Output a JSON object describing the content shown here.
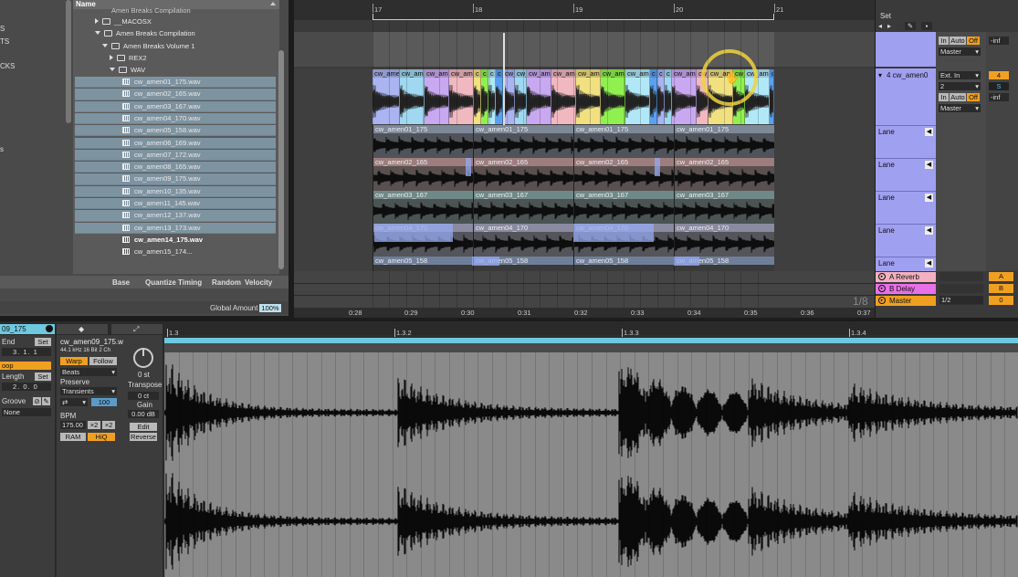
{
  "browser": {
    "header_name": "Name",
    "top_cut": "Amen Breaks Compilation",
    "folders": [
      {
        "label": "__MACOSX",
        "indent": 1,
        "open": false
      },
      {
        "label": "Amen Breaks Compilation",
        "indent": 1,
        "open": true
      },
      {
        "label": "Amen Breaks Volume 1",
        "indent": 2,
        "open": true
      },
      {
        "label": "REX2",
        "indent": 3,
        "open": false
      },
      {
        "label": "WAV",
        "indent": 3,
        "open": true
      }
    ],
    "files": [
      "cw_amen01_175.wav",
      "cw_amen02_165.wav",
      "cw_amen03_167.wav",
      "cw_amen04_170.wav",
      "cw_amen05_158.wav",
      "cw_amen06_169.wav",
      "cw_amen07_172.wav",
      "cw_amen08_165.wav",
      "cw_amen09_175.wav",
      "cw_amen10_135.wav",
      "cw_amen11_145.wav",
      "cw_amen12_137.wav",
      "cw_amen13_173.wav",
      "cw_amen14_175.wav",
      "cw_amen15_174..."
    ],
    "left_labels": [
      "S",
      "TS",
      "CKS",
      "s"
    ],
    "groove_cols": [
      "Base",
      "Quantize",
      "Timing",
      "Random",
      "Velocity"
    ],
    "global_amount_label": "Global Amount",
    "global_amount_value": "100%"
  },
  "arrangement": {
    "bars": [
      "17",
      "18",
      "19",
      "20",
      "21"
    ],
    "times": [
      "0:28",
      "0:29",
      "0:30",
      "0:31",
      "0:32",
      "0:33",
      "0:34",
      "0:35",
      "0:36",
      "0:37"
    ],
    "zoom_label": "1/8",
    "lanes": [
      {
        "name": "cw_amen01_175",
        "color": "#7d8898",
        "wave": "#111"
      },
      {
        "name": "cw_amen02_165",
        "color": "#9d7d7d",
        "wave": "#111"
      },
      {
        "name": "cw_amen03_167",
        "color": "#6f8888",
        "wave": "#111"
      },
      {
        "name": "cw_amen04_170",
        "color": "#8a8aa0",
        "wave": "#111"
      },
      {
        "name": "cw_amen05_158",
        "color": "#6f7f9a",
        "wave": "#111"
      }
    ],
    "comp_label": "cw_amen",
    "comp_short": "c",
    "comp_colors": [
      "#aab4f0",
      "#9fd8f0",
      "#c8a8f0",
      "#f0b8c0",
      "#f0e080",
      "#90f050",
      "#b0e8f8",
      "#5aa0f0"
    ]
  },
  "mixer": {
    "set_label": "Set",
    "track_name": "4 cw_amen0",
    "track_number": "4",
    "lane_label": "Lane",
    "in_label": "In",
    "auto_label": "Auto",
    "off_label": "Off",
    "master_label": "Master",
    "ext_in": "Ext. In",
    "channel": "2",
    "inf": "-inf",
    "returns": [
      {
        "name": "A Reverb",
        "color": "#f2b0c0",
        "letter": "A"
      },
      {
        "name": "B Delay",
        "color": "#e870e8",
        "letter": "B"
      },
      {
        "name": "Master",
        "color": "#f0a020",
        "letter": "0"
      }
    ],
    "master_ratio": "1/2"
  },
  "clip": {
    "name_short": "09_175",
    "end_label": "End",
    "set_label": "Set",
    "end_value": "3.  1.  1",
    "loop_label": "oop",
    "length_label": "Length",
    "length_value": "2.  0.  0",
    "groove_label": "Groove",
    "groove_value": "None",
    "file_name": "cw_amen09_175.w",
    "file_info": "44.1 kHz  16 Bit  2 Ch",
    "warp": "Warp",
    "follow": "Follow",
    "mode": "Beats",
    "preserve_label": "Preserve",
    "preserve_value": "Transients",
    "loop_icon": "⇄",
    "amount": "100",
    "bpm_label": "BPM",
    "bpm_value": "175.00",
    "half": "×2",
    "double": "×2",
    "ram": "RAM",
    "hiq": "HiQ",
    "transpose_value": "0 st",
    "transpose_label": "Transpose",
    "detune": "0 ct",
    "gain_label": "Gain",
    "gain_value": "0.00 dB",
    "edit": "Edit",
    "reverse": "Reverse",
    "markers": [
      "1.3",
      "1.3.2",
      "1.3.3",
      "1.3.4"
    ]
  }
}
